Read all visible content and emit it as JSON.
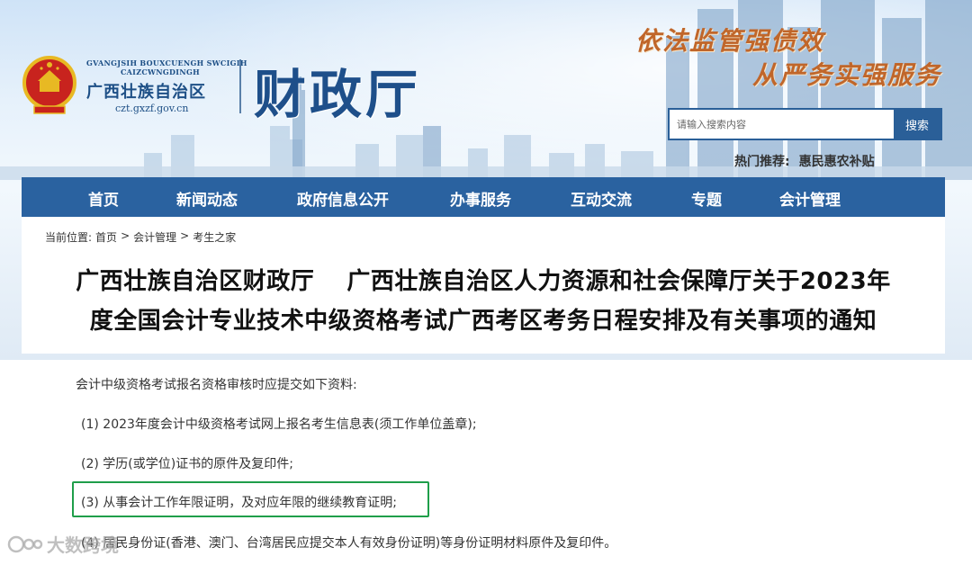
{
  "header": {
    "roman_line_1": "GVANGJSIH BOUXCUENGH SWCIGIH",
    "roman_line_2": "CAIZCWNGDINGH",
    "region": "广西壮族自治区",
    "domain": "czt.gxzf.gov.cn",
    "department": "财政厅",
    "slogan_1": "依法监管强债效",
    "slogan_2": "从严务实强服务",
    "emblem_icon": "national-emblem-icon"
  },
  "search": {
    "placeholder": "请输入搜索内容",
    "button_label": "搜索"
  },
  "hot": {
    "label": "热门推荐:",
    "link": "惠民惠农补贴"
  },
  "nav": {
    "items": [
      {
        "label": "首页"
      },
      {
        "label": "新闻动态"
      },
      {
        "label": "政府信息公开"
      },
      {
        "label": "办事服务"
      },
      {
        "label": "互动交流"
      },
      {
        "label": "专题"
      },
      {
        "label": "会计管理"
      }
    ]
  },
  "breadcrumb": {
    "prefix": "当前位置:",
    "items": [
      "首页",
      "会计管理",
      "考生之家"
    ],
    "separator": ">"
  },
  "article": {
    "title_line_1": "广西壮族自治区财政厅　 广西壮族自治区人力资源和社会保障厅关于2023年",
    "title_line_2": "度全国会计专业技术中级资格考试广西考区考务日程安排及有关事项的通知",
    "intro": "会计中级资格考试报名资格审核时应提交如下资料:",
    "items": [
      "(1) 2023年度会计中级资格考试网上报名考生信息表(须工作单位盖章);",
      "(2) 学历(或学位)证书的原件及复印件;",
      "(3) 从事会计工作年限证明，及对应年限的继续教育证明;",
      "(4) 居民身份证(香港、澳门、台湾居民应提交本人有效身份证明)等身份证明材料原件及复印件。"
    ]
  },
  "watermark": {
    "text": "大数跨境"
  },
  "colors": {
    "nav_bg": "#2a62a0",
    "highlight": "#1f9e4a",
    "slogan": "#c0662a",
    "brand_blue": "#1e4f8a"
  }
}
